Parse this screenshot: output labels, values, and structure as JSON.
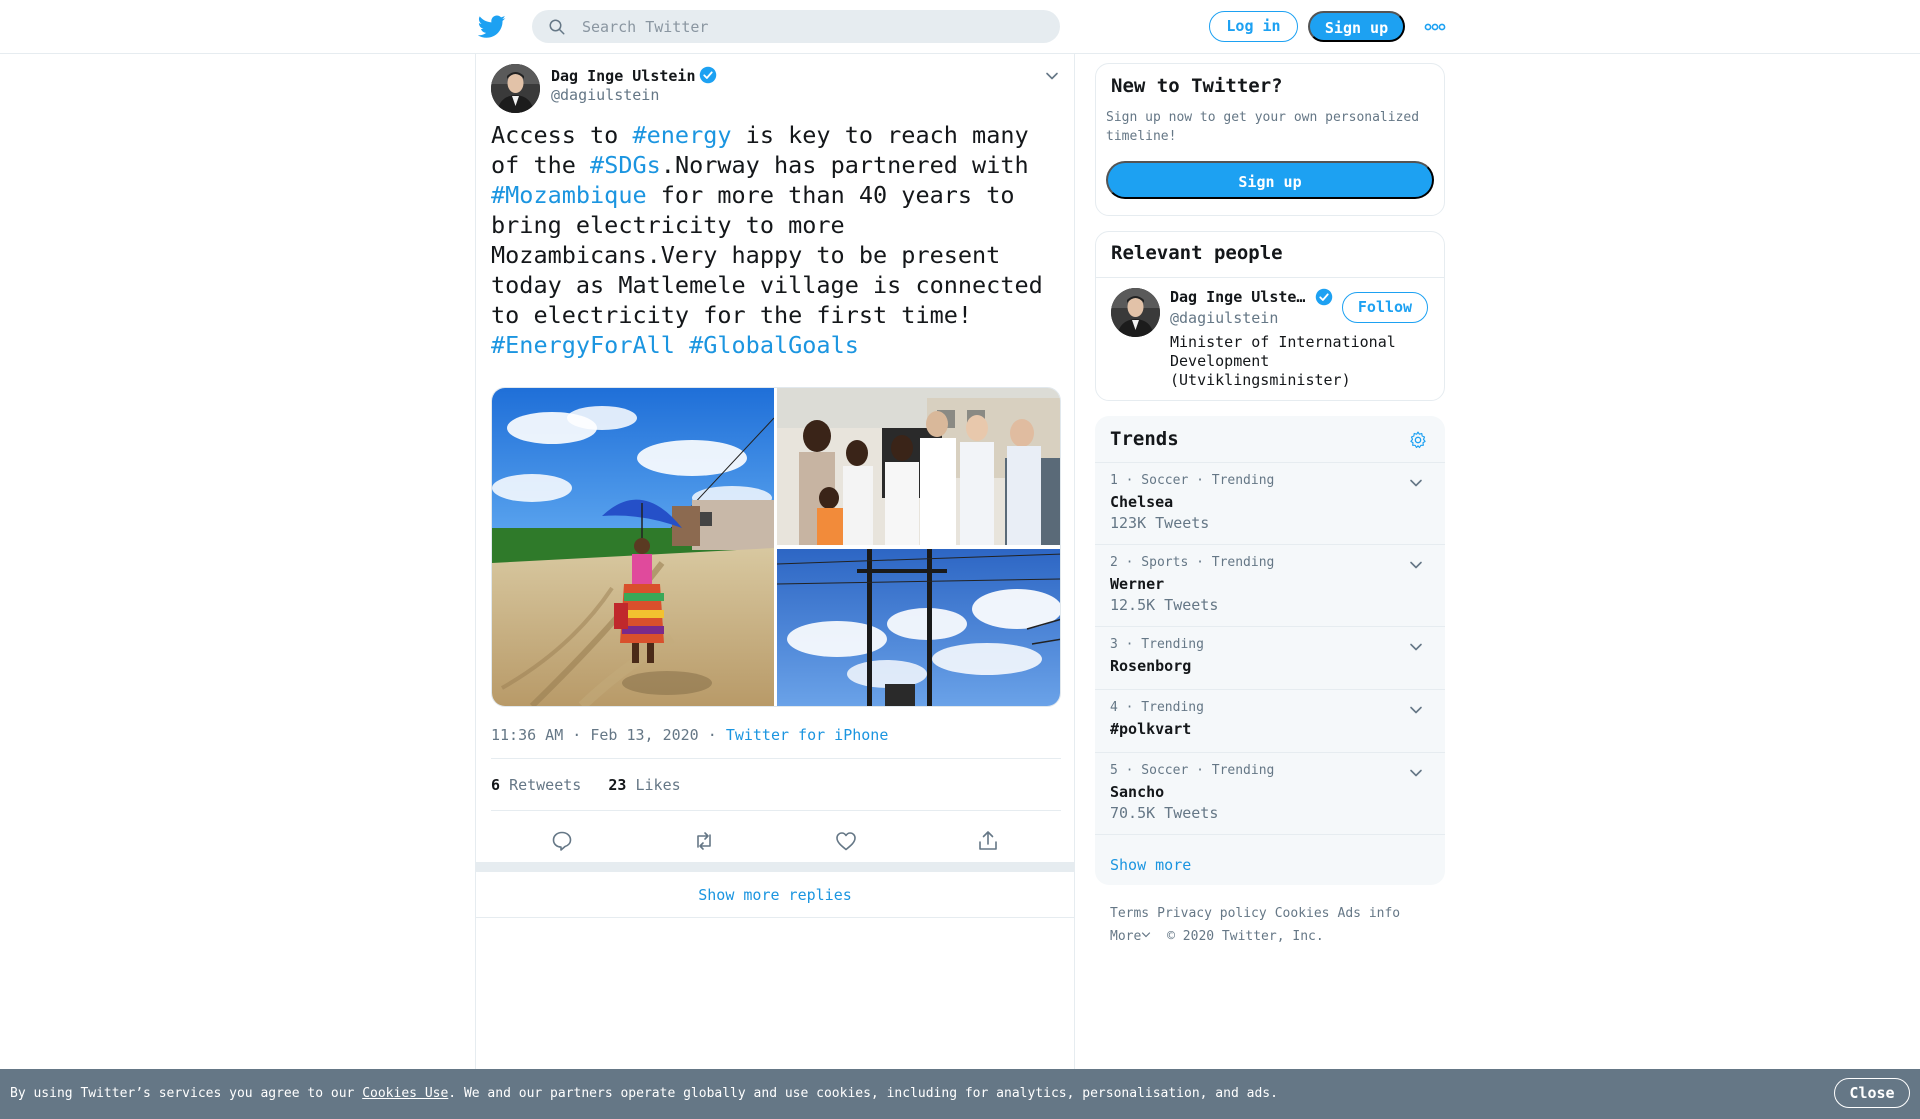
{
  "header": {
    "search_placeholder": "Search Twitter",
    "login_label": "Log in",
    "signup_label": "Sign up"
  },
  "tweet": {
    "author_name": "Dag Inge Ulstein",
    "author_handle": "@dagiulstein",
    "text_parts": {
      "p1": "Access to ",
      "h1": "#energy",
      "p2": " is key to reach many of the ",
      "h2": "#SDGs",
      "p3": ".Norway has partnered with ",
      "h3": "#Mozambique",
      "p4": " for more than 40 years to bring electricity to more Mozambicans.Very happy to be present today as Matlemele village is connected to electricity for the first time! ",
      "h4": "#EnergyForAll",
      "p5": " ",
      "h5": "#GlobalGoals"
    },
    "time": "11:36 AM",
    "date": "Feb 13, 2020",
    "source": "Twitter for iPhone",
    "retweets_count": "6",
    "retweets_label": "Retweets",
    "likes_count": "23",
    "likes_label": "Likes",
    "show_more_replies": "Show more replies"
  },
  "sidebar": {
    "new_to_twitter": {
      "title": "New to Twitter?",
      "description": "Sign up now to get your own personalized timeline!",
      "signup_label": "Sign up"
    },
    "relevant_people": {
      "title": "Relevant people",
      "name": "Dag Inge Ulste…",
      "handle": "@dagiulstein",
      "follow_label": "Follow",
      "bio": "Minister of International Development (Utviklingsminister)"
    },
    "trends": {
      "title": "Trends",
      "items": [
        {
          "meta": "1 · Soccer · Trending",
          "name": "Chelsea",
          "count": "123K Tweets"
        },
        {
          "meta": "2 · Sports · Trending",
          "name": "Werner",
          "count": "12.5K Tweets"
        },
        {
          "meta": "3 · Trending",
          "name": "Rosenborg",
          "count": ""
        },
        {
          "meta": "4 · Trending",
          "name": "#polkvart",
          "count": ""
        },
        {
          "meta": "5 · Soccer · Trending",
          "name": "Sancho",
          "count": "70.5K Tweets"
        }
      ],
      "show_more": "Show more"
    },
    "footer": {
      "terms": "Terms",
      "privacy": "Privacy policy",
      "cookies": "Cookies",
      "ads_info": "Ads info",
      "more": "More",
      "copyright": "© 2020 Twitter, Inc."
    }
  },
  "cookie_bar": {
    "text_before": "By using Twitter’s services you agree to our ",
    "link": "Cookies Use",
    "text_after": ". We and our partners operate globally and use cookies, including for analytics, personalisation, and ads.",
    "close_label": "Close"
  },
  "colors": {
    "accent": "#1da1f2",
    "link": "#1b95e0",
    "muted": "#657786",
    "border": "#e6ecf0",
    "cookie_bar": "#657786"
  },
  "icons": [
    "twitter-bird",
    "search",
    "more-dots",
    "verified-badge",
    "chevron-down",
    "reply",
    "retweet",
    "like",
    "share",
    "gear"
  ]
}
